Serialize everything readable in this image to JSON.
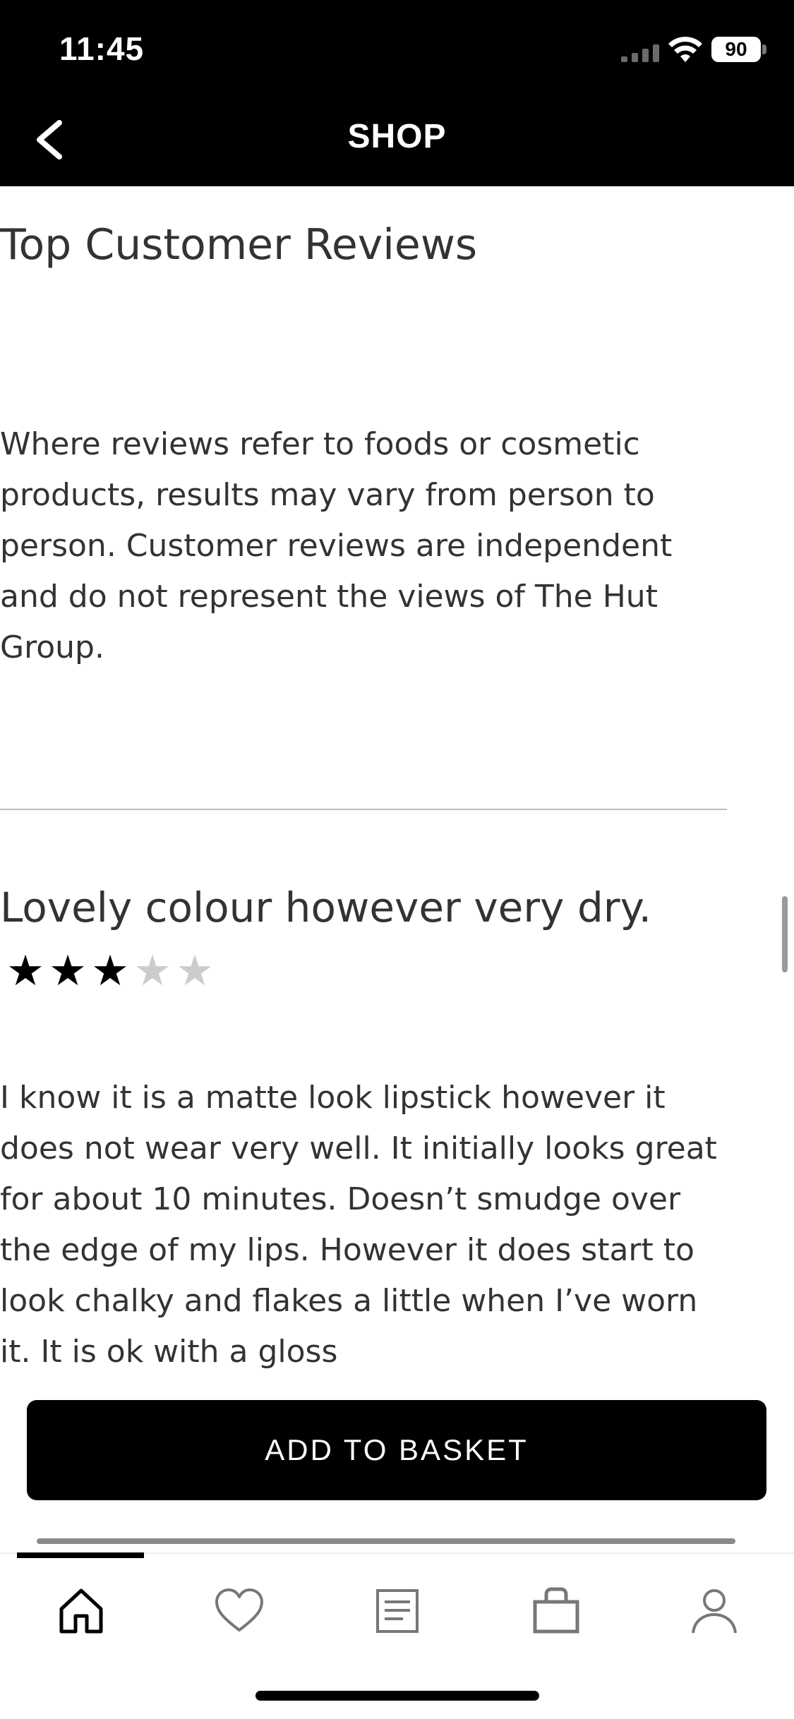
{
  "status_bar": {
    "time": "11:45",
    "battery": "90"
  },
  "nav": {
    "title": "SHOP",
    "back_icon": "chevron-left-icon"
  },
  "reviews": {
    "section_title": "Top Customer Reviews",
    "disclaimer": "Where reviews refer to foods or cosmetic products, results may vary from person to person. Customer reviews are independent and do not represent the views of The Hut Group.",
    "items": [
      {
        "title": "Lovely colour however very dry.",
        "rating": 3,
        "rating_max": 5,
        "body": "I know it is a matte look lipstick however it does not wear very well. It initially looks great for about 10 minutes. Doesn’t smudge over the edge of my lips. However it does start to look chalky and flakes a little when I’ve worn it. It is ok with a gloss"
      }
    ]
  },
  "actions": {
    "add_to_basket": "ADD TO BASKET"
  },
  "tab_bar": {
    "active": "home",
    "items": [
      {
        "id": "home",
        "icon": "home-icon"
      },
      {
        "id": "wishlist",
        "icon": "heart-icon"
      },
      {
        "id": "lists",
        "icon": "document-icon"
      },
      {
        "id": "basket",
        "icon": "bag-icon"
      },
      {
        "id": "account",
        "icon": "person-icon"
      }
    ]
  },
  "colors": {
    "bar_background": "#000000",
    "text": "#333333",
    "star_filled": "#000000",
    "star_empty": "#cccccc"
  }
}
